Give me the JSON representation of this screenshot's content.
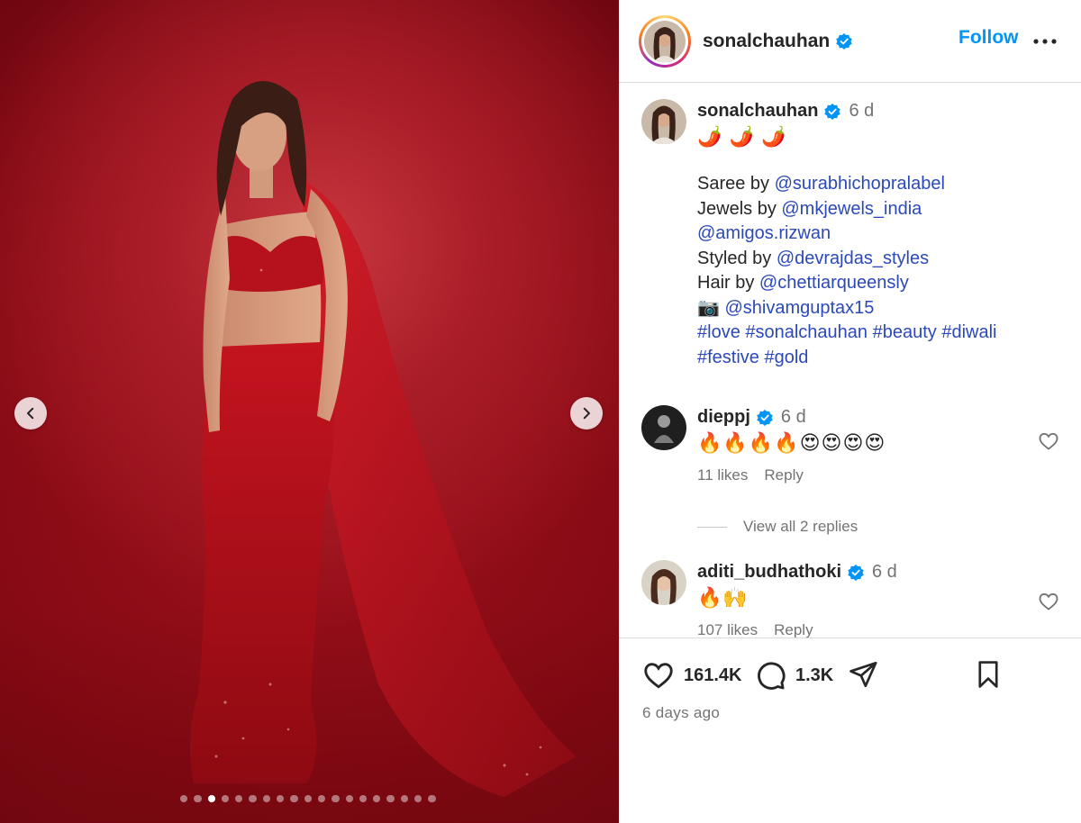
{
  "carousel": {
    "prev_icon": "chevron-left-icon",
    "next_icon": "chevron-right-icon",
    "dot_count": 19,
    "active_index": 2
  },
  "colors": {
    "link": "#2b49b8",
    "follow": "#0095f6",
    "verified": "#0095f6",
    "backdrop": "#a3151f"
  },
  "header": {
    "username": "sonalchauhan",
    "follow_label": "Follow",
    "more_icon": "more-options-icon"
  },
  "caption": {
    "username": "sonalchauhan",
    "time": "6 d",
    "emoji_line": "🌶️ 🌶️ 🌶️",
    "lines": [
      {
        "prefix": "Saree by ",
        "link": "@surabhichopralabel"
      },
      {
        "prefix": "Jewels by ",
        "link": "@mkjewels_india"
      },
      {
        "prefix": "",
        "link": "@amigos.rizwan"
      },
      {
        "prefix": "Styled by ",
        "link": "@devrajdas_styles"
      },
      {
        "prefix": "Hair by ",
        "link": "@chettiarqueensly"
      },
      {
        "prefix": "📷 ",
        "link": "@shivamguptax15"
      }
    ],
    "tags_line1": "#love #sonalchauhan #beauty #diwali",
    "tags_line2": "#festive #gold"
  },
  "comments": [
    {
      "username": "dieppj",
      "time": "6 d",
      "text": "🔥🔥🔥🔥😍😍😍😍",
      "likes": "11 likes",
      "reply_label": "Reply"
    },
    {
      "username": "aditi_budhathoki",
      "time": "6 d",
      "text": "🔥🙌",
      "likes": "107 likes",
      "reply_label": "Reply"
    }
  ],
  "view_replies": "View all 2 replies",
  "actions": {
    "likes": "161.4K",
    "comments": "1.3K",
    "posted": "6 days ago"
  }
}
